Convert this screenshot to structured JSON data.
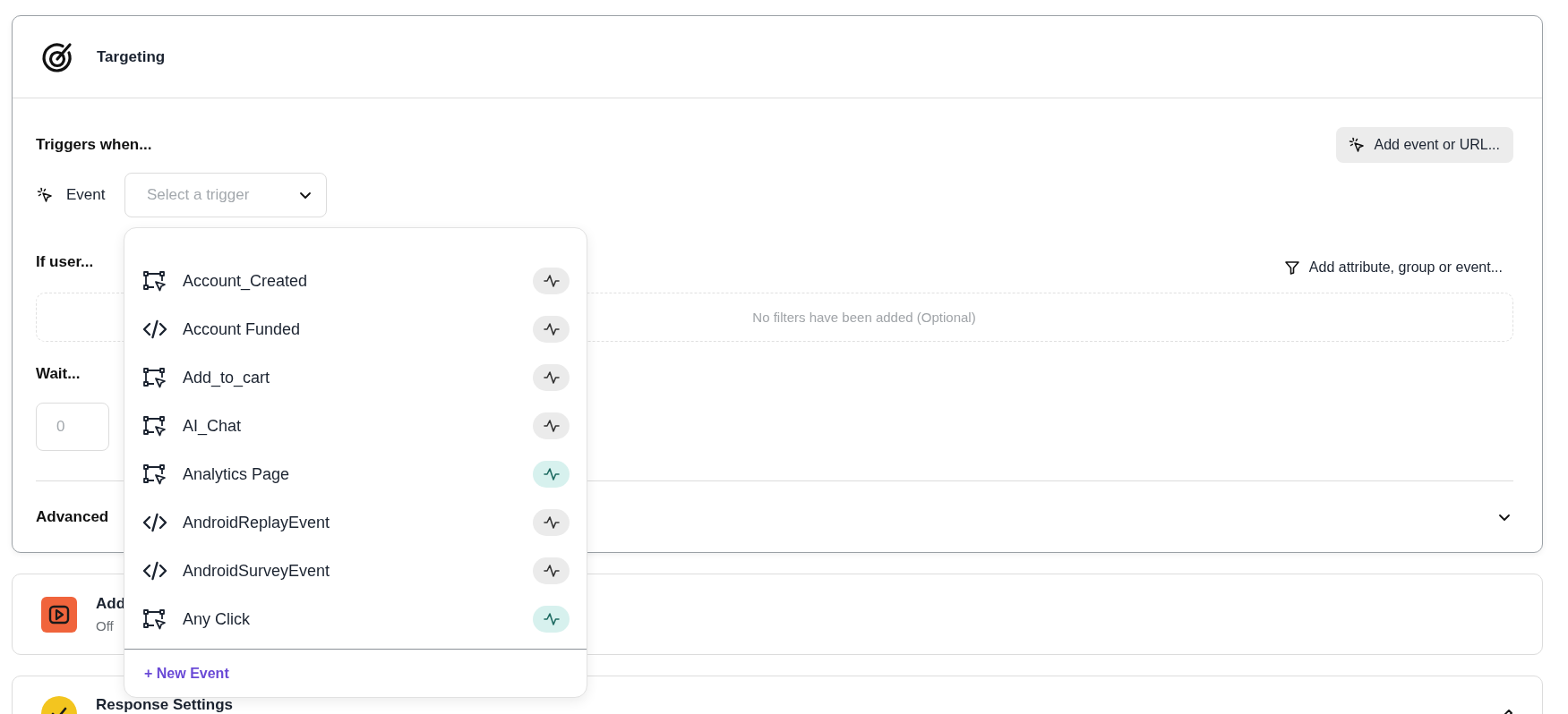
{
  "targeting": {
    "title": "Targeting",
    "triggers": {
      "label": "Triggers when...",
      "add_button": "Add event or URL...",
      "event_label": "Event",
      "select": {
        "placeholder": "Select a trigger",
        "expanded": true
      }
    },
    "dropdown": {
      "items": [
        {
          "label": "Account_Created",
          "kind": "custom",
          "active": false
        },
        {
          "label": "Account Funded",
          "kind": "code",
          "active": false
        },
        {
          "label": "Add_to_cart",
          "kind": "custom",
          "active": false
        },
        {
          "label": "AI_Chat",
          "kind": "custom",
          "active": false
        },
        {
          "label": "Analytics Page",
          "kind": "custom",
          "active": true
        },
        {
          "label": "AndroidReplayEvent",
          "kind": "code",
          "active": false
        },
        {
          "label": "AndroidSurveyEvent",
          "kind": "code",
          "active": false
        },
        {
          "label": "Any Click",
          "kind": "custom",
          "active": true
        }
      ],
      "new_event": "+ New Event"
    },
    "filters": {
      "label": "If user...",
      "add_button": "Add attribute, group or event...",
      "empty": "No filters have been added (Optional)"
    },
    "wait": {
      "label": "Wait...",
      "placeholder": "0"
    },
    "advanced": {
      "label": "Advanced",
      "expanded": false
    }
  },
  "cards": [
    {
      "title": "Add",
      "status": "Off"
    },
    {
      "title": "Response Settings"
    }
  ]
}
